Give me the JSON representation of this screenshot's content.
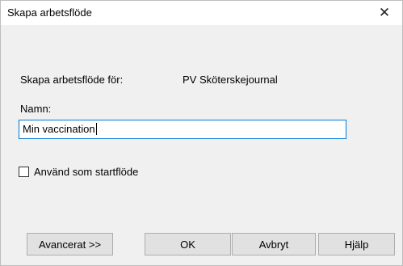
{
  "dialog": {
    "title": "Skapa arbetsflöde",
    "close_symbol": "✕"
  },
  "form": {
    "for_label": "Skapa arbetsflöde för:",
    "for_value": "PV Sköterskejournal",
    "name_label": "Namn:",
    "name_value": "Min vaccination",
    "start_flow_label": "Använd som startflöde",
    "start_flow_checked": false
  },
  "buttons": {
    "advanced": "Avancerat >>",
    "ok": "OK",
    "cancel": "Avbryt",
    "help": "Hjälp"
  }
}
